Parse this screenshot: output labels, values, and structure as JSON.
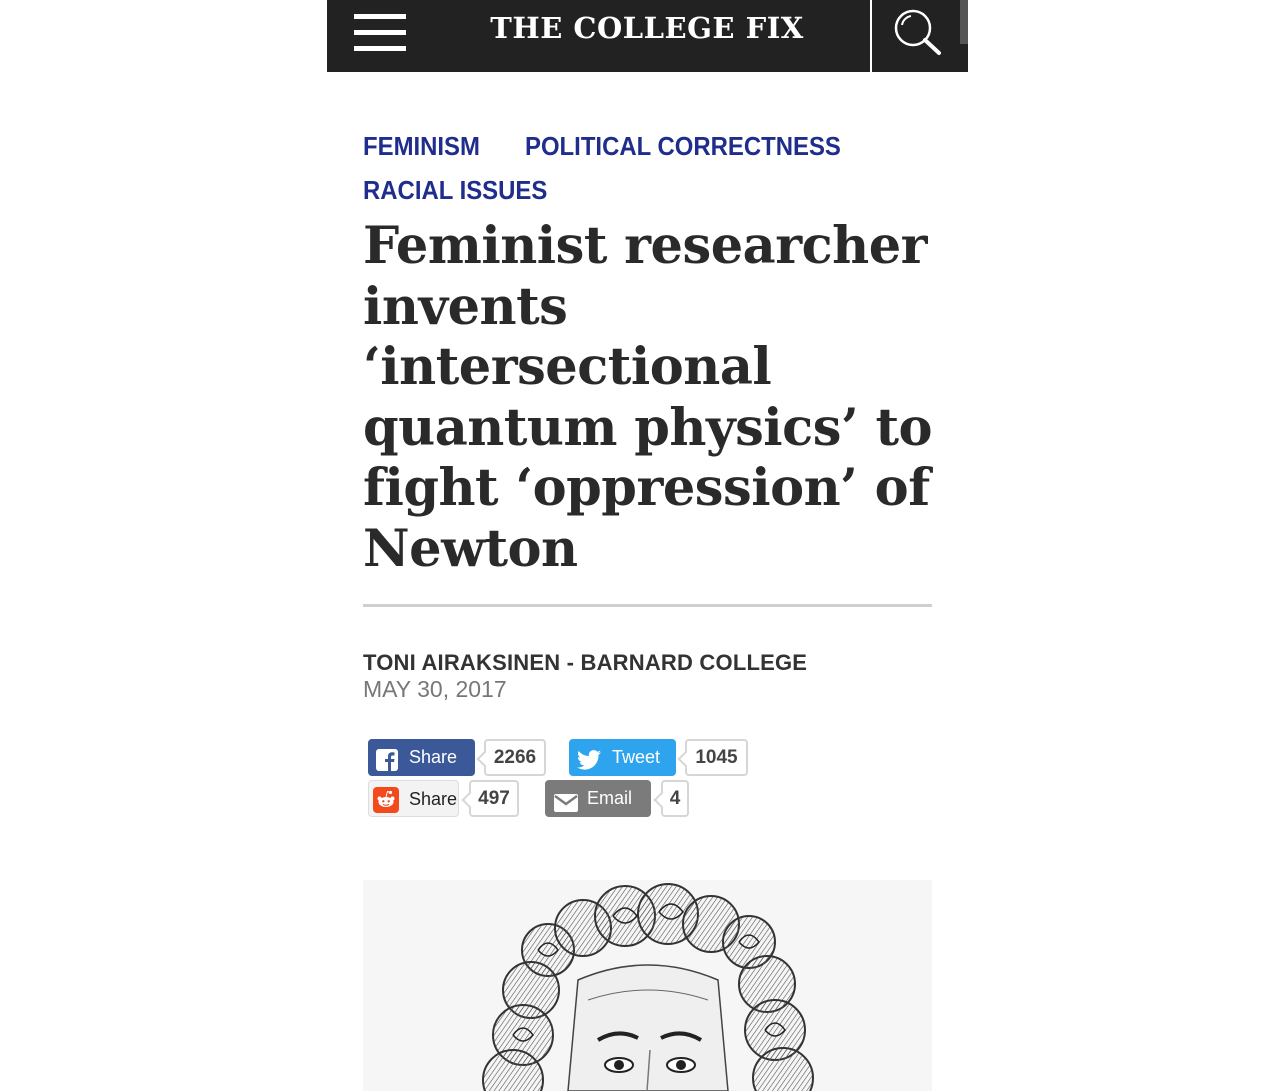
{
  "header": {
    "site_name": "THE COLLEGE FIX"
  },
  "categories": [
    "FEMINISM",
    "POLITICAL CORRECTNESS",
    "RACIAL ISSUES"
  ],
  "article": {
    "headline_lines": [
      "Feminist researcher",
      "invents",
      "‘intersectional",
      "quantum physics’ to",
      "fight ‘oppression’ of",
      "Newton"
    ],
    "byline": "TONI AIRAKSINEN - BARNARD COLLEGE",
    "date": "MAY 30, 2017"
  },
  "share": {
    "facebook": {
      "label": "Share",
      "count": "2266",
      "color": "#3b5998"
    },
    "twitter": {
      "label": "Tweet",
      "count": "1045",
      "color": "#2fa4ee"
    },
    "reddit": {
      "label": "Share",
      "count": "497",
      "color": "#f24a1c"
    },
    "email": {
      "label": "Email",
      "count": "4",
      "color": "#7b7b7b"
    }
  },
  "icons": [
    "menu-icon",
    "search-icon",
    "facebook-icon",
    "twitter-icon",
    "reddit-icon",
    "email-icon"
  ]
}
